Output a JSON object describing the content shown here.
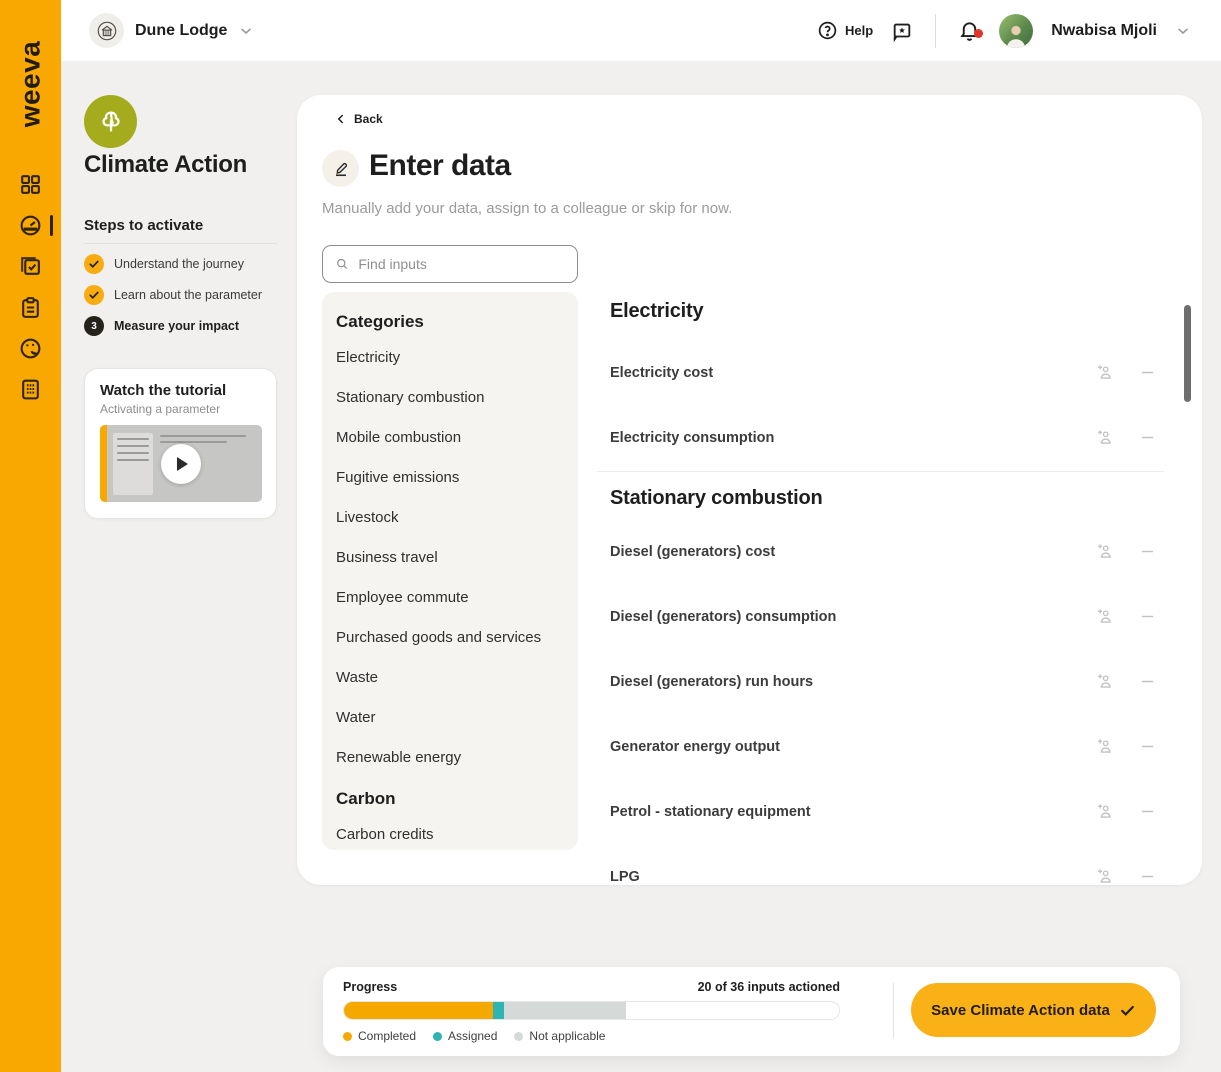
{
  "brand": {
    "logo_text": "weeva"
  },
  "header": {
    "org_name": "Dune Lodge",
    "help_label": "Help",
    "user_name": "Nwabisa Mjoli"
  },
  "panel": {
    "title": "Climate Action",
    "steps_title": "Steps to activate",
    "steps": [
      {
        "label": "Understand the journey",
        "state": "done"
      },
      {
        "label": "Learn about the parameter",
        "state": "done"
      },
      {
        "label": "Measure your impact",
        "state": "current",
        "number": "3"
      }
    ],
    "tutorial": {
      "title": "Watch the tutorial",
      "subtitle": "Activating a parameter"
    }
  },
  "main": {
    "back_label": "Back",
    "title": "Enter data",
    "subtitle": "Manually add your data, assign to a colleague or skip for now.",
    "search_placeholder": "Find inputs",
    "categories_title": "Categories",
    "categories": [
      "Electricity",
      "Stationary combustion",
      "Mobile combustion",
      "Fugitive emissions",
      "Livestock",
      "Business travel",
      "Employee commute",
      "Purchased goods and services",
      "Waste",
      "Water",
      "Renewable energy"
    ],
    "categories_group2_title": "Carbon",
    "categories_group2": [
      "Carbon credits"
    ],
    "sections": [
      {
        "title": "Electricity",
        "rows": [
          "Electricity cost",
          "Electricity consumption"
        ]
      },
      {
        "title": "Stationary combustion",
        "rows": [
          "Diesel (generators) cost",
          "Diesel (generators) consumption",
          "Diesel (generators) run hours",
          "Generator energy output",
          "Petrol - stationary equipment",
          "LPG"
        ]
      }
    ]
  },
  "footer": {
    "progress_label": "Progress",
    "progress_status": "20 of 36 inputs actioned",
    "segments": [
      {
        "name": "Completed",
        "color": "#F5A800",
        "pct": 30
      },
      {
        "name": "Assigned",
        "color": "#2CB5B2",
        "pct": 2.4
      },
      {
        "name": "Not applicable",
        "color": "#D5DAD8",
        "pct": 24.5
      }
    ],
    "save_label": "Save Climate Action data"
  },
  "colors": {
    "accent_orange": "#F8A800",
    "olive": "#A4AC1D",
    "teal": "#2CB5B2",
    "notification_red": "#E2342B"
  }
}
